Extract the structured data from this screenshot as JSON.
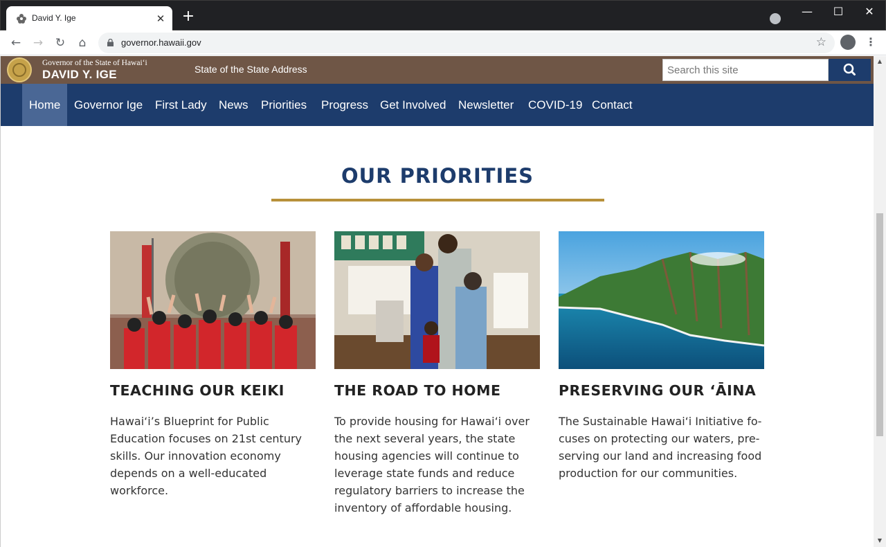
{
  "browser": {
    "tab_title": "David Y. Ige",
    "url": "governor.hawaii.gov"
  },
  "site": {
    "governor_subtitle": "Governor of the State of Hawai‘i",
    "governor_name": "DAVID Y. IGE",
    "header_link": "State of the State Address",
    "search_placeholder": "Search this site"
  },
  "nav": {
    "items": [
      {
        "label": "Home",
        "active": true
      },
      {
        "label": "Governor Ige"
      },
      {
        "label": "First Lady"
      },
      {
        "label": "News"
      },
      {
        "label": "Priorities"
      },
      {
        "label": "Progress"
      },
      {
        "label": "Get Involved"
      },
      {
        "label": "Newsletter"
      },
      {
        "label": "COVID-19"
      },
      {
        "label": "Contact"
      }
    ]
  },
  "priorities": {
    "title": "OUR PRIORITIES",
    "cards": [
      {
        "title": "TEACHING OUR KEIKI",
        "text": "Hawai‘i’s Blueprint for Public Education focuses on 21st century skills. Our in­novation economy depends on a well-educated workforce."
      },
      {
        "title": "THE ROAD TO HOME",
        "text": "To provide housing for Hawai‘i over the next several years, the state housing agencies will continue to leverage state funds and reduce regulatory barriers to increase the inventory of affordable housing."
      },
      {
        "title": "PRESERVING OUR ‘ĀINA",
        "text": "The Sustainable Hawai‘i Initiative fo­cuses on protecting our waters, pre­serving our land and increasing food production for our communities."
      }
    ]
  }
}
